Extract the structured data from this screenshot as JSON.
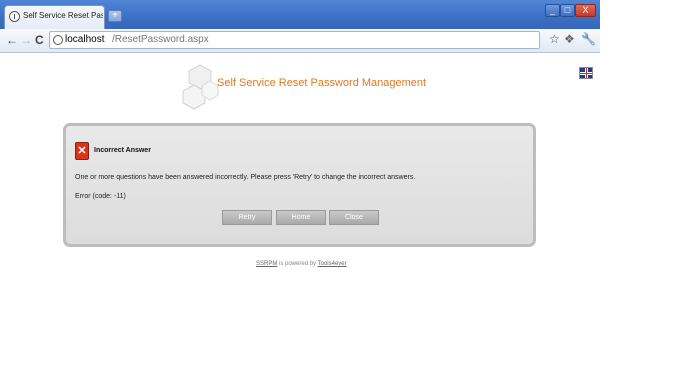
{
  "browser": {
    "tab_title": "Self Service Reset Password",
    "new_tab_icon": "plus-icon",
    "window_controls": {
      "minimize": "_",
      "maximize": "□",
      "close": "X"
    },
    "address": {
      "host": "localhost",
      "path": "/ResetPassword.aspx"
    },
    "icons": [
      "back-arrow-icon",
      "forward-arrow-icon",
      "reload-icon",
      "page-icon",
      "star-icon",
      "page-menu-icon",
      "wrench-icon"
    ]
  },
  "page": {
    "logo_text": "Self Service Reset Password Management",
    "language_flag": "uk-flag-icon",
    "dialog": {
      "title": "Incorrect Answer",
      "message": "One or more questions have been answered incorrectly. Please press 'Retry' to change the incorrect answers.",
      "error_code": "Error (code: -11)",
      "buttons": {
        "retry": "Retry",
        "home": "Home",
        "close": "Close"
      }
    },
    "footer": {
      "product_link": "SSRPM",
      "middle": " is powered by ",
      "vendor_link": "Tools4ever"
    }
  },
  "colors": {
    "accent": "#e07a1f",
    "error": "#d8341e",
    "titlebar": "#3b6fc4"
  }
}
